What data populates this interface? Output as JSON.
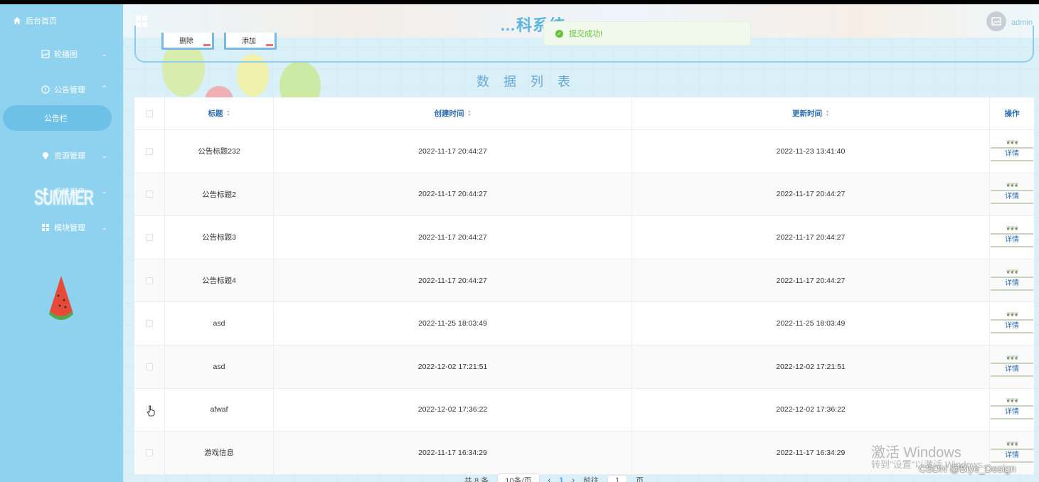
{
  "sidebar": {
    "home_label": "后台首页",
    "menus": [
      {
        "label": "轮播图",
        "icon": "image-icon"
      },
      {
        "label": "公告管理",
        "icon": "info-circle-icon"
      },
      {
        "label": "资源管理",
        "icon": "lightbulb-icon"
      },
      {
        "label": "系统用户",
        "icon": "user-icon"
      },
      {
        "label": "模块管理",
        "icon": "grid-icon"
      }
    ],
    "active_sub": "公告栏",
    "deco_text": "SUMMER"
  },
  "header": {
    "title": "…科系统",
    "user": "admin"
  },
  "toast": {
    "message": "提交成功!"
  },
  "toolbar": {
    "delete_label": "删除",
    "add_label": "添加"
  },
  "list_title": "数据列表",
  "table": {
    "columns": [
      "标题",
      "创建时间",
      "更新时间",
      "操作"
    ],
    "rows": [
      {
        "title": "公告标题232",
        "created": "2022-11-17 20:44:27",
        "updated": "2022-11-23 13:41:40",
        "action": "详情"
      },
      {
        "title": "公告标题2",
        "created": "2022-11-17 20:44:27",
        "updated": "2022-11-17 20:44:27",
        "action": "详情"
      },
      {
        "title": "公告标题3",
        "created": "2022-11-17 20:44:27",
        "updated": "2022-11-17 20:44:27",
        "action": "详情"
      },
      {
        "title": "公告标题4",
        "created": "2022-11-17 20:44:27",
        "updated": "2022-11-17 20:44:27",
        "action": "详情"
      },
      {
        "title": "asd",
        "created": "2022-11-25 18:03:49",
        "updated": "2022-11-25 18:03:49",
        "action": "详情"
      },
      {
        "title": "asd",
        "created": "2022-12-02 17:21:51",
        "updated": "2022-12-02 17:21:51",
        "action": "详情"
      },
      {
        "title": "afwaf",
        "created": "2022-12-02 17:36:22",
        "updated": "2022-12-02 17:36:22",
        "action": "详情"
      },
      {
        "title": "游戏信息",
        "created": "2022-11-17 16:34:29",
        "updated": "2022-11-17 16:34:29",
        "action": "详情"
      }
    ]
  },
  "pager": {
    "total": "共 8 条",
    "page_size": "10条/页",
    "current_page": "1",
    "goto_label": "前往",
    "goto_value": "1",
    "page_suffix": "页"
  },
  "watermark": {
    "line1": "激活 Windows",
    "line2": "转到\"设置\"以激活 Windows。",
    "csdn": "CSDN @Biye_Design"
  }
}
